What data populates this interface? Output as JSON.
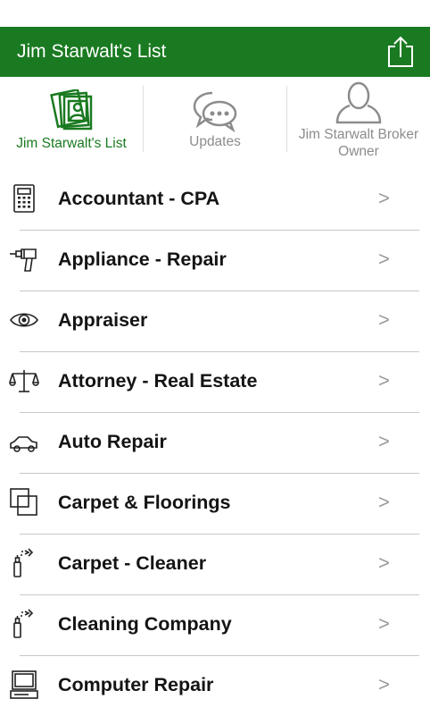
{
  "header": {
    "title": "Jim Starwalt's List"
  },
  "tabs": [
    {
      "label": "Jim Starwalt's List",
      "icon": "contacts-cards-icon",
      "active": true,
      "color": "#1a7a21"
    },
    {
      "label": "Updates",
      "icon": "chat-bubbles-icon",
      "active": false,
      "color": "#8c8c8c"
    },
    {
      "label": "Jim Starwalt  Broker Owner",
      "label_line1": "Jim Starwalt  Broker",
      "label_line2": "Owner",
      "icon": "person-silhouette-icon",
      "active": false,
      "color": "#8c8c8c"
    }
  ],
  "list": {
    "chevron": ">",
    "items": [
      {
        "label": "Accountant - CPA",
        "icon": "calculator-icon"
      },
      {
        "label": "Appliance - Repair",
        "icon": "drill-icon"
      },
      {
        "label": "Appraiser",
        "icon": "eye-icon"
      },
      {
        "label": "Attorney - Real Estate",
        "icon": "scales-icon"
      },
      {
        "label": "Auto Repair",
        "icon": "car-icon"
      },
      {
        "label": "Carpet & Floorings",
        "icon": "overlapping-squares-icon"
      },
      {
        "label": "Carpet - Cleaner",
        "icon": "spray-bottle-icon"
      },
      {
        "label": "Cleaning Company",
        "icon": "spray-bottle-icon"
      },
      {
        "label": "Computer Repair",
        "icon": "computer-icon"
      }
    ]
  },
  "colors": {
    "header_bg": "#1a7a21",
    "accent": "#1a7a21",
    "inactive": "#8c8c8c",
    "chevron": "#9a9a9a"
  }
}
